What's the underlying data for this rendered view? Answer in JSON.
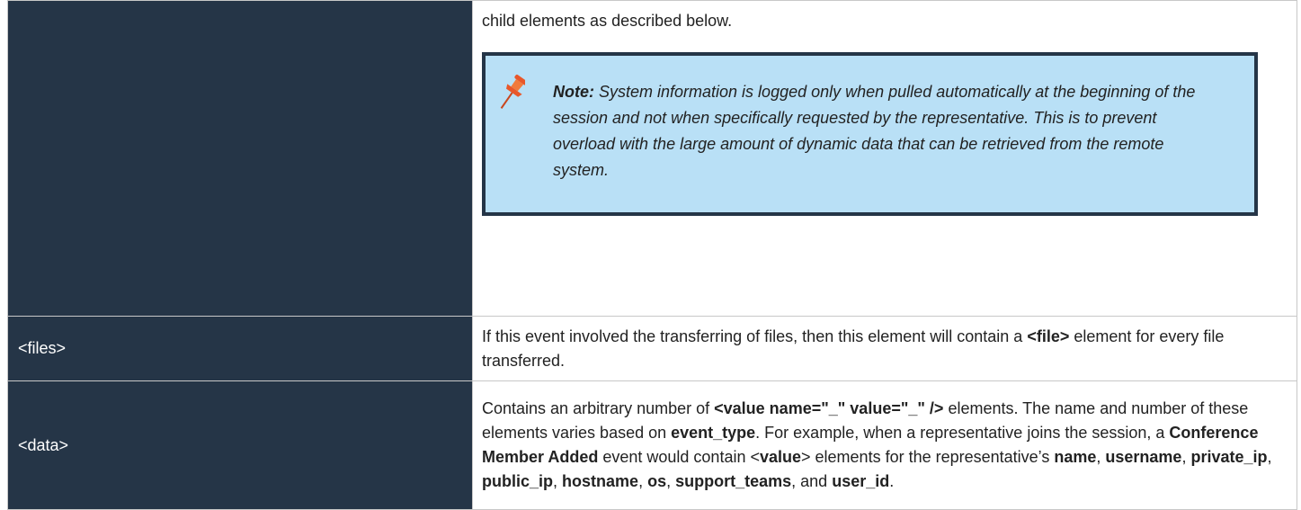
{
  "rows": [
    {
      "key": "",
      "desc_intro": "child elements as described below.",
      "note": {
        "label": "Note:",
        "text": " System information is logged only when pulled automatically at the beginning of the session and not when specifically requested by the representative. This is to prevent overload with the large amount of dynamic data that can be retrieved from the remote system."
      }
    },
    {
      "key": "<files>",
      "desc": {
        "p1": "If this event involved the transferring of files, then this element will contain a ",
        "b1": "<file>",
        "p2": " element for every file transferred."
      }
    },
    {
      "key": "<data>",
      "desc": {
        "p1": "Contains an arbitrary number of ",
        "b1": "<value name=\"_\" value=\"_\" />",
        "p2": " elements. The name and number of these elements varies based on ",
        "b2": "event_type",
        "p3": ". For example, when a representative joins the session, a ",
        "b3": "Conference Member Added",
        "p4": " event would contain <",
        "b4": "value",
        "p5": "> elements for the representative’s ",
        "b5": "name",
        "p6": ", ",
        "b6": "username",
        "p7": ", ",
        "b7": "private_ip",
        "p8": ", ",
        "b8": "public_ip",
        "p9": ", ",
        "b9": "hostname",
        "p10": ", ",
        "b10": "os",
        "p11": ", ",
        "b11": "support_teams",
        "p12": ", and ",
        "b12": "user_id",
        "p13": "."
      }
    }
  ],
  "colors": {
    "key_bg": "#253547",
    "note_bg": "#b9e0f6",
    "note_border": "#253547",
    "pin": "#e8572a"
  },
  "icons": {
    "note": "pushpin-icon"
  }
}
